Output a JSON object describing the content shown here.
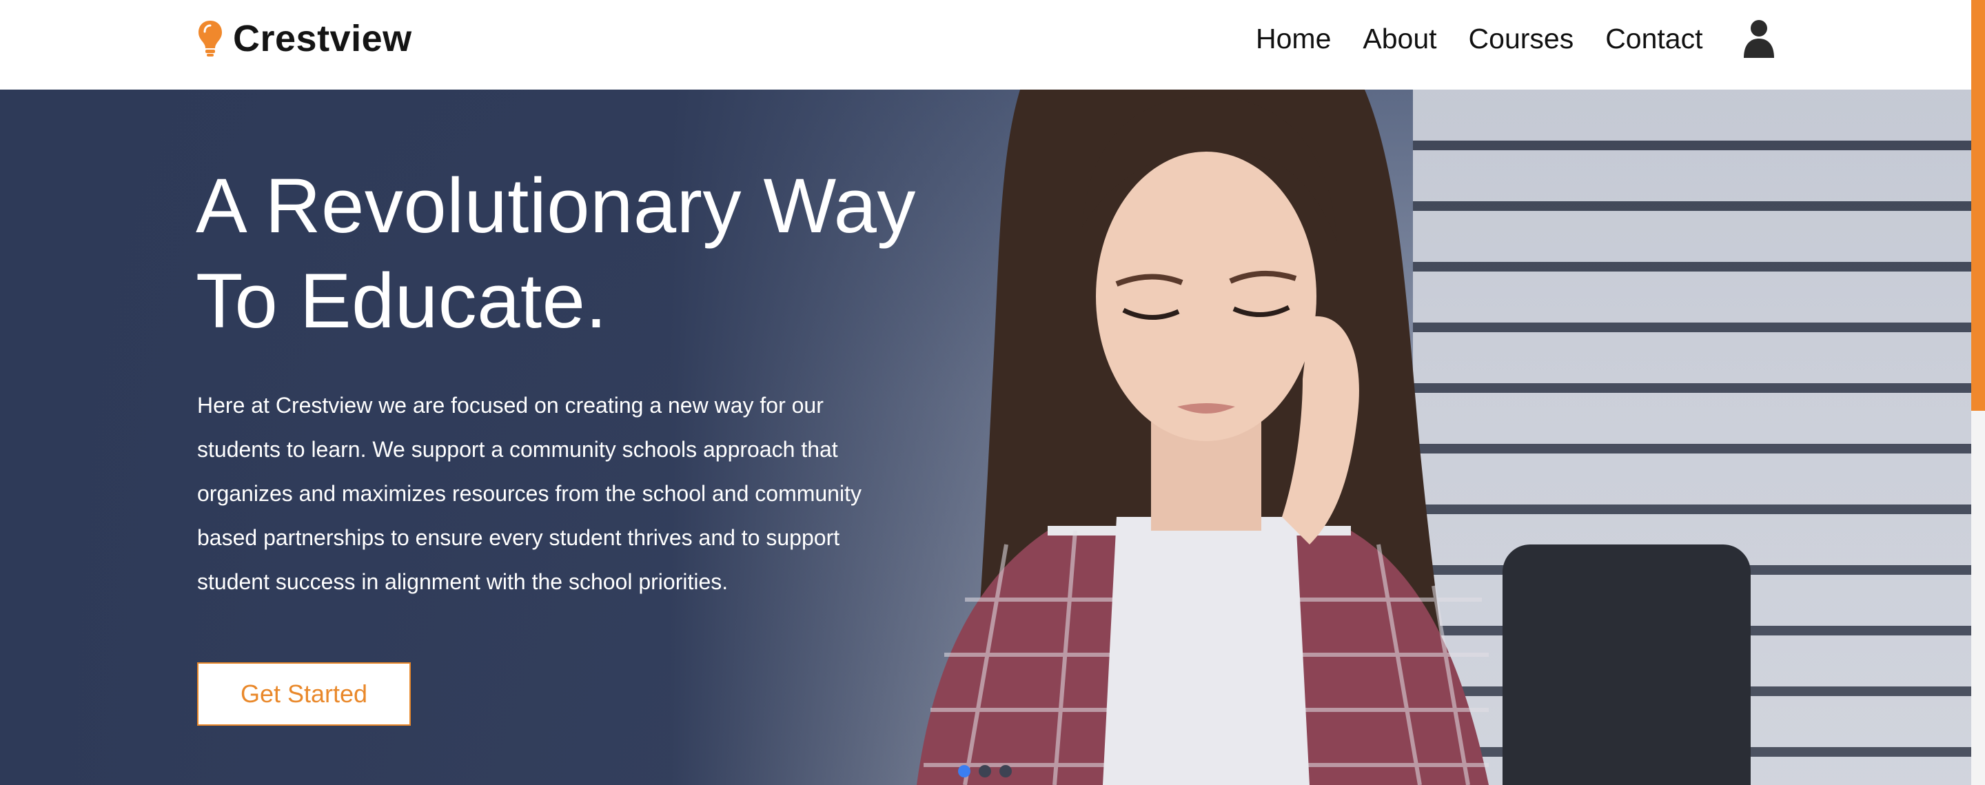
{
  "header": {
    "brand": "Crestview",
    "nav_items": [
      "Home",
      "About",
      "Courses",
      "Contact"
    ]
  },
  "hero": {
    "title_lines": [
      "A Revolutionary Way",
      "To Educate."
    ],
    "paragraph_lines": [
      "Here at Crestview we are focused on creating a new way for our",
      "students to learn. We support a community schools approach that",
      "organizes and maximizes resources from the school and community",
      "based partnerships to ensure every student thrives and to support",
      "student success in alignment with the school priorities."
    ],
    "cta_label": "Get Started",
    "carousel": {
      "total": 3,
      "active": 1
    }
  },
  "colors": {
    "accent": "#e9882a",
    "hero_overlay": "#2e3a58",
    "active_dot": "#3a7ef0"
  },
  "icons": {
    "logo": "lightbulb-icon",
    "account": "user-icon"
  }
}
